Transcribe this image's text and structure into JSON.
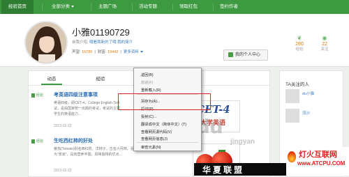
{
  "nav": {
    "items": [
      {
        "label": "经验首页"
      },
      {
        "label": "全部分类"
      },
      {
        "label": "主题广场"
      },
      {
        "label": "活动专题"
      },
      {
        "label": "领取红包"
      },
      {
        "label": "签约作者"
      }
    ]
  },
  "profile": {
    "username": "小雅01190729",
    "intro_label": "自我介绍:",
    "intro_text": "哦看我新的了哦 我的简介",
    "reputation_label": "声望:",
    "reputation": "16780",
    "wealth_label": "财富:",
    "wealth": "19442",
    "more_label": "更多资料",
    "center_button": "我的个人中心",
    "stats": [
      {
        "value": "280",
        "label": "经验"
      },
      {
        "value": "22",
        "label": "关注"
      }
    ]
  },
  "tabs": [
    {
      "label": "动态"
    },
    {
      "label": "经验"
    }
  ],
  "articles": [
    {
      "tag": "经验",
      "title": "考英语四级注意事项",
      "desc_lines": [
        "英语四级，即CET-4，College English Test",
        "试，是由国家统一出题的考试，考试的主要",
        "学生的英语能力..."
      ],
      "date": "2013-02-22"
    },
    {
      "tag": "经验",
      "title": "生吃西红柿的好处",
      "desc_lines": [
        "番茄(Tomato)别名西红杭、洋柿子，古名六月柿、喜报三元",
        "为\"浆液\"，具有营养丰富，风味独特的优点..."
      ],
      "date": "2013-02-22"
    }
  ],
  "thumb1": {
    "title": "CET-4",
    "subtitle": "大学英语"
  },
  "sidebar": {
    "heading": "TA关注的人",
    "users": [
      {
        "name": "du小猫"
      },
      {
        "name": "流沙"
      }
    ]
  },
  "context_menu": {
    "items": [
      {
        "label": "返回(B)",
        "enabled": true
      },
      {
        "label": "前进(F)",
        "enabled": false
      },
      {
        "label": "重新载入(R)",
        "enabled": true
      },
      {
        "label": "另存为(A)...",
        "enabled": true
      },
      {
        "label": "打印(P)...",
        "enabled": true
      },
      {
        "label": "投射(C)...",
        "enabled": true
      },
      {
        "label": "翻译成中文（简体中文）(T)",
        "enabled": true
      },
      {
        "label": "查看网页源代码(V)",
        "enabled": true
      },
      {
        "label": "查看网页信息(J)",
        "enabled": true
      },
      {
        "label": "审查元素(N)",
        "enabled": true
      }
    ]
  },
  "watermarks": {
    "baidu": "Baidu",
    "baidu_sub": "jingyan",
    "badge_line1": "灯火互联网",
    "badge_line2": "www.ATCPU.COM",
    "huaxia": "华夏联盟"
  },
  "colors": {
    "nav_green": "#3e9a41",
    "link_blue": "#2a6ab0",
    "highlight_red": "#e02020",
    "number_orange": "#e07b00"
  }
}
